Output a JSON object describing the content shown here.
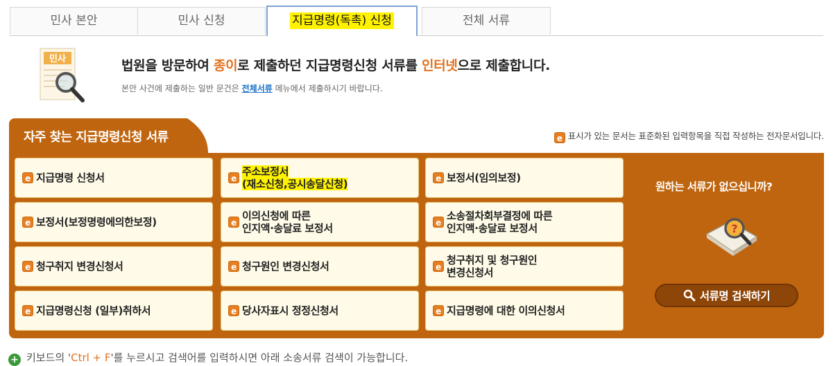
{
  "tabs": [
    {
      "label": "민사 본안",
      "active": false
    },
    {
      "label": "민사 신청",
      "active": false
    },
    {
      "label": "지급명령(독촉) 신청",
      "active": true
    },
    {
      "label": "전체 서류",
      "active": false
    }
  ],
  "intro": {
    "icon_text": "민사",
    "title_pre": "법원을 방문하여 ",
    "title_em1": "종이",
    "title_mid": "로 제출하던 지급명령신청 서류를 ",
    "title_em2": "인터넷",
    "title_post": "으로 제출합니다.",
    "sub_pre": "본안 사건에 제출하는 일반 문건은 ",
    "sub_link": "전체서류",
    "sub_post": " 메뉴에서 제출하시기 바랍니다."
  },
  "panel": {
    "title": "자주 찾는 지급명령신청 서류",
    "note_badge": "e",
    "note": "표시가 있는 문서는 표준화된 입력항목을 직접 작성하는 전자문서입니다.",
    "docs": [
      {
        "badge": "e",
        "line1": "지급명령 신청서",
        "line2": ""
      },
      {
        "badge": "e",
        "line1": "주소보정서",
        "line2": "(재소신청,공시송달신청)"
      },
      {
        "badge": "e",
        "line1": "보정서(임의보정)",
        "line2": ""
      },
      {
        "badge": "e",
        "line1": "보정서(보정명령에의한보정)",
        "line2": ""
      },
      {
        "badge": "e",
        "line1": "이의신청에 따른",
        "line2": "인지액·송달료 보정서"
      },
      {
        "badge": "e",
        "line1": "소송절차회부결정에 따른",
        "line2": "인지액·송달료 보정서"
      },
      {
        "badge": "e",
        "line1": "청구취지 변경신청서",
        "line2": ""
      },
      {
        "badge": "e",
        "line1": "청구원인 변경신청서",
        "line2": ""
      },
      {
        "badge": "e",
        "line1": "청구취지 및 청구원인",
        "line2": "변경신청서"
      },
      {
        "badge": "e",
        "line1": "지급명령신청 (일부)취하서",
        "line2": ""
      },
      {
        "badge": "e",
        "line1": "당사자표시 정정신청서",
        "line2": ""
      },
      {
        "badge": "e",
        "line1": "지급명령에 대한 이의신청서",
        "line2": ""
      }
    ],
    "side_title": "원하는 서류가 없으십니까?",
    "search_button": "서류명 검색하기"
  },
  "tip": {
    "pre": "키보드의 '",
    "em": "Ctrl + F",
    "post": "'를 누르시고 검색어를 입력하시면 아래 소송서류 검색이 가능합니다."
  },
  "colors": {
    "panel": "#c0650f",
    "accent": "#e2701c",
    "highlight": "#fff200",
    "link": "#1a6fc9"
  }
}
